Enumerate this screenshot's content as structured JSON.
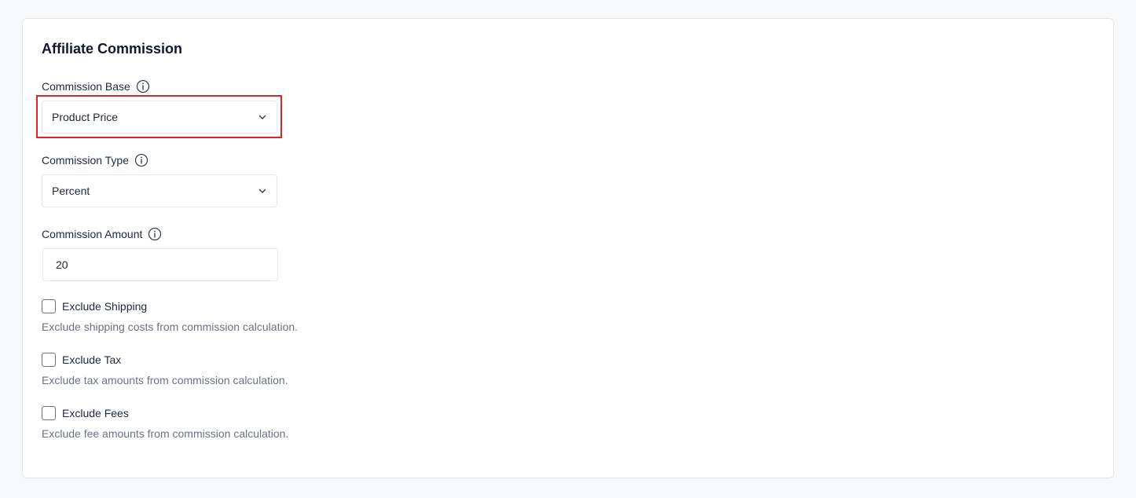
{
  "section": {
    "title": "Affiliate Commission"
  },
  "commission_base": {
    "label": "Commission Base",
    "selected": "Product Price"
  },
  "commission_type": {
    "label": "Commission Type",
    "selected": "Percent"
  },
  "commission_amount": {
    "label": "Commission Amount",
    "value": "20"
  },
  "exclusions": [
    {
      "label": "Exclude Shipping",
      "help": "Exclude shipping costs from commission calculation.",
      "checked": false
    },
    {
      "label": "Exclude Tax",
      "help": "Exclude tax amounts from commission calculation.",
      "checked": false
    },
    {
      "label": "Exclude Fees",
      "help": "Exclude fee amounts from commission calculation.",
      "checked": false
    }
  ],
  "colors": {
    "highlight": "#d62828",
    "border": "#e5e7eb",
    "text": "#1f2937",
    "muted": "#6b7280"
  }
}
